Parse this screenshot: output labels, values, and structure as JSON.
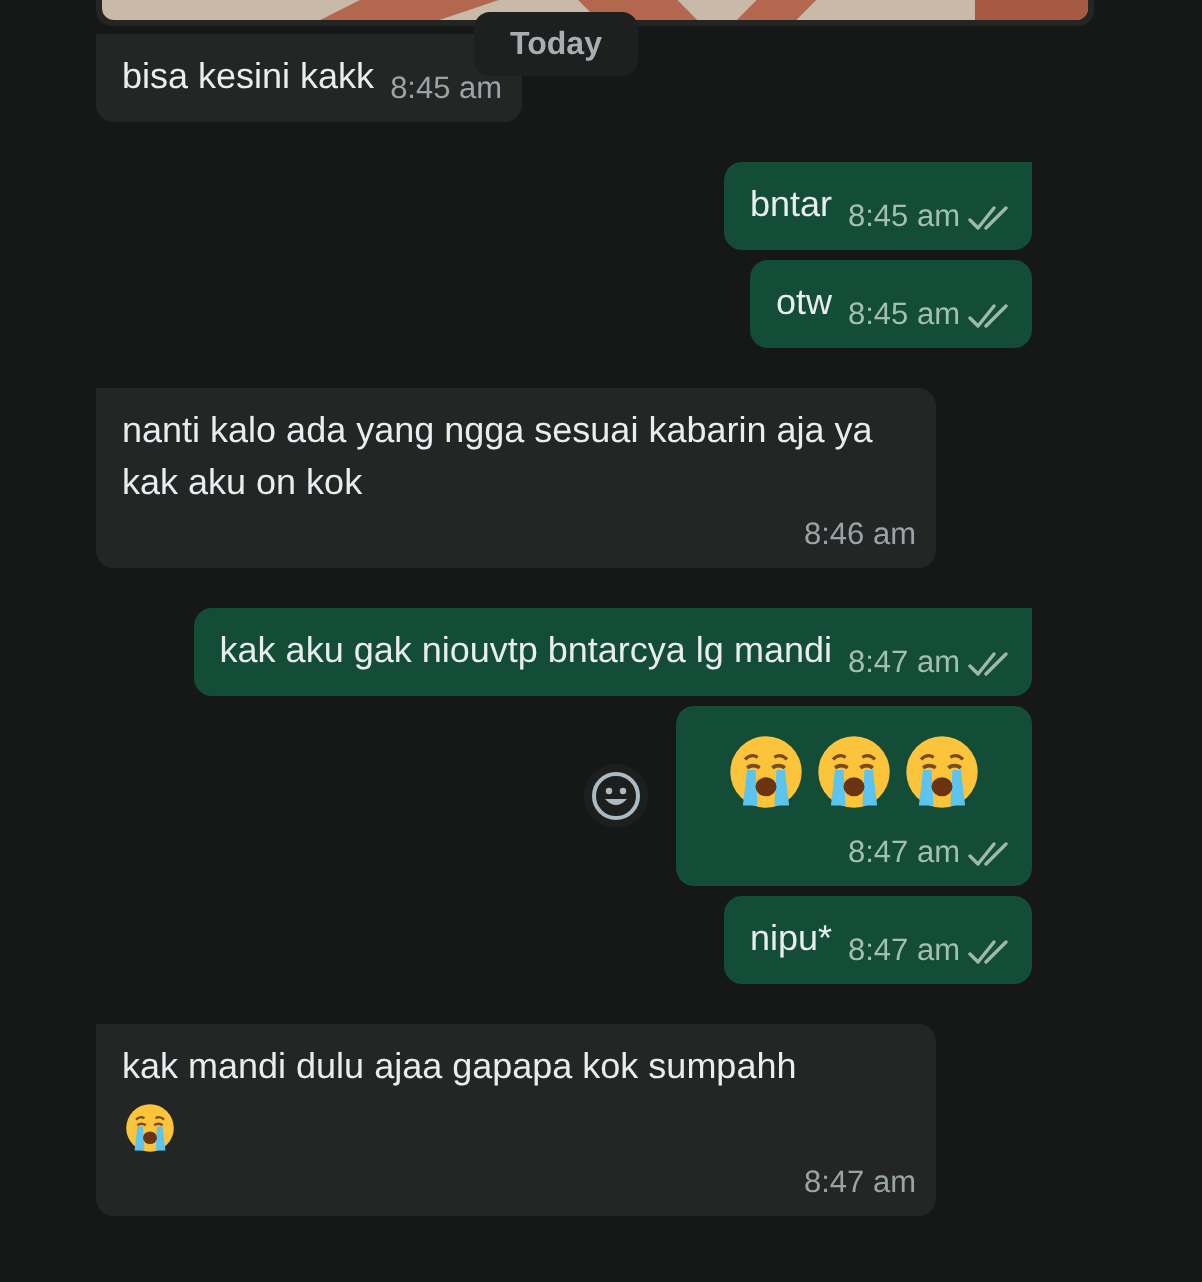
{
  "date_chip": "Today",
  "messages": [
    {
      "outgoing": false,
      "text": "bisa kesini kakk",
      "time": "8:45 am"
    },
    {
      "outgoing": true,
      "text": "bntar",
      "time": "8:45 am",
      "read": false
    },
    {
      "outgoing": true,
      "text": "otw",
      "time": "8:45 am",
      "read": false
    },
    {
      "outgoing": false,
      "text": "nanti kalo ada yang ngga sesuai kabarin aja ya kak aku on kok",
      "time": "8:46 am"
    },
    {
      "outgoing": true,
      "text": "kak aku gak niouvtp bntarcya lg mandi",
      "time": "8:47 am",
      "read": false
    },
    {
      "outgoing": true,
      "emojis": [
        {
          "kind": "crying"
        },
        {
          "kind": "crying"
        },
        {
          "kind": "crying"
        }
      ],
      "time": "8:47 am",
      "read": false,
      "react_button": true
    },
    {
      "outgoing": true,
      "text": "nipu*",
      "time": "8:47 am",
      "read": false
    },
    {
      "outgoing": false,
      "text": "kak mandi dulu ajaa gapapa kok sumpahh",
      "emojis": [
        {
          "kind": "crying"
        }
      ],
      "time": "8:47 am"
    }
  ]
}
